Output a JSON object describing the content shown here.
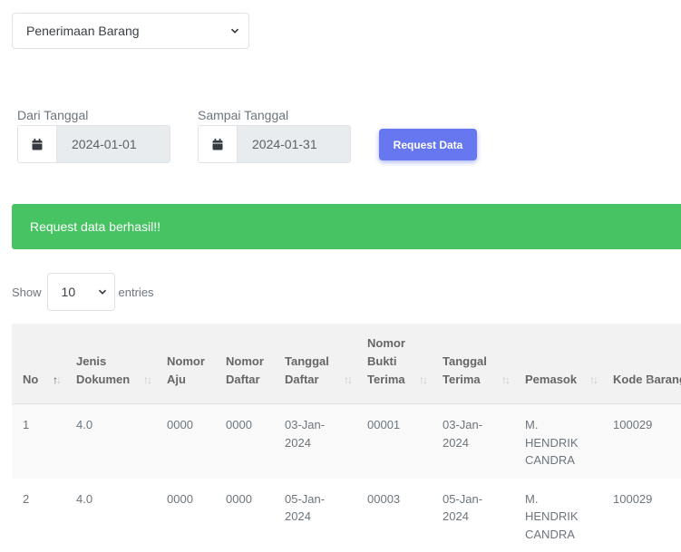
{
  "report_select": {
    "value": "Penerimaan Barang"
  },
  "filters": {
    "from_label": "Dari Tanggal",
    "from_value": "2024-01-01",
    "to_label": "Sampai Tanggal",
    "to_value": "2024-01-31",
    "request_button": "Request Data"
  },
  "alert": {
    "message": "Request data berhasil!!",
    "color": "#47c363"
  },
  "entries": {
    "show_label": "Show",
    "value": "10",
    "suffix_label": "entries"
  },
  "table": {
    "columns": [
      "No",
      "Jenis Dokumen",
      "Nomor Aju",
      "Nomor Daftar",
      "Tanggal Daftar",
      "Nomor Bukti Terima",
      "Tanggal Terima",
      "Pemasok",
      "Kode Barang"
    ],
    "rows": [
      [
        "1",
        "4.0",
        "0000",
        "0000",
        "03-Jan-2024",
        "00001",
        "03-Jan-2024",
        "M. HENDRIK CANDRA",
        "100029"
      ],
      [
        "2",
        "4.0",
        "0000",
        "0000",
        "05-Jan-2024",
        "00003",
        "05-Jan-2024",
        "M. HENDRIK CANDRA",
        "100029"
      ]
    ]
  },
  "colors": {
    "accent": "#6777ef",
    "success": "#47c363",
    "header_bg": "#f2f2f2"
  },
  "icons": {
    "calendar": "calendar-icon",
    "dropdown": "chevron-down-icon",
    "sort": "sort-icon"
  }
}
